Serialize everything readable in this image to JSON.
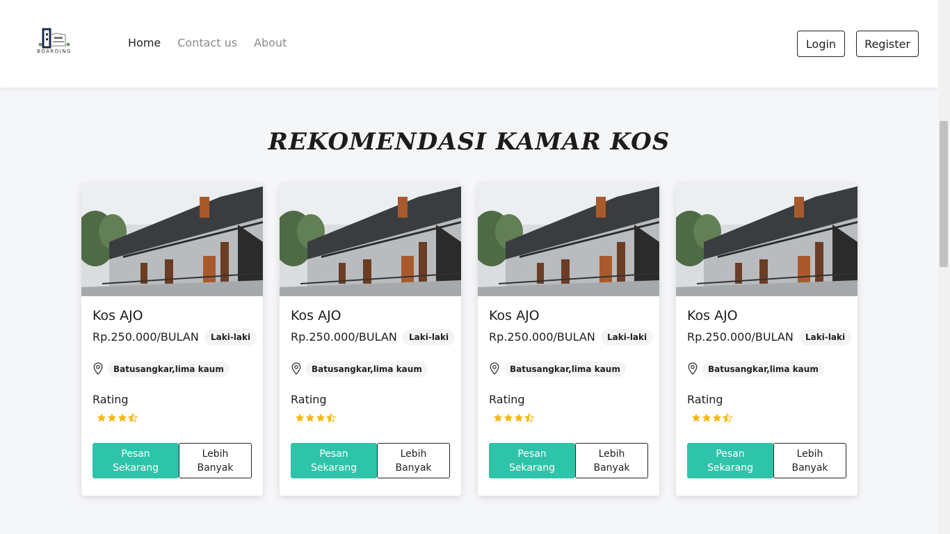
{
  "brand": {
    "logo_text": "BOARDING"
  },
  "nav": {
    "links": [
      {
        "label": "Home",
        "active": true
      },
      {
        "label": "Contact us",
        "active": false
      },
      {
        "label": "About",
        "active": false
      }
    ],
    "login_label": "Login",
    "register_label": "Register"
  },
  "section": {
    "title": "REKOMENDASI KAMAR KOS"
  },
  "colors": {
    "accent": "#2ec4a9",
    "star": "#f5b80f"
  },
  "cards": [
    {
      "name": "Kos AJO",
      "price": "Rp.250.000/BULAN",
      "gender": "Laki-laki",
      "location": "Batusangkar,lima kaum",
      "rating_label": "Rating",
      "rating": 3.5,
      "order_label_1": "Pesan",
      "order_label_2": "Sekarang",
      "more_label_1": "Lebih",
      "more_label_2": "Banyak"
    },
    {
      "name": "Kos AJO",
      "price": "Rp.250.000/BULAN",
      "gender": "Laki-laki",
      "location": "Batusangkar,lima kaum",
      "rating_label": "Rating",
      "rating": 3.5,
      "order_label_1": "Pesan",
      "order_label_2": "Sekarang",
      "more_label_1": "Lebih",
      "more_label_2": "Banyak"
    },
    {
      "name": "Kos AJO",
      "price": "Rp.250.000/BULAN",
      "gender": "Laki-laki",
      "location": "Batusangkar,lima kaum",
      "rating_label": "Rating",
      "rating": 3.5,
      "order_label_1": "Pesan",
      "order_label_2": "Sekarang",
      "more_label_1": "Lebih",
      "more_label_2": "Banyak"
    },
    {
      "name": "Kos AJO",
      "price": "Rp.250.000/BULAN",
      "gender": "Laki-laki",
      "location": "Batusangkar,lima kaum",
      "rating_label": "Rating",
      "rating": 3.5,
      "order_label_1": "Pesan",
      "order_label_2": "Sekarang",
      "more_label_1": "Lebih",
      "more_label_2": "Banyak"
    }
  ]
}
